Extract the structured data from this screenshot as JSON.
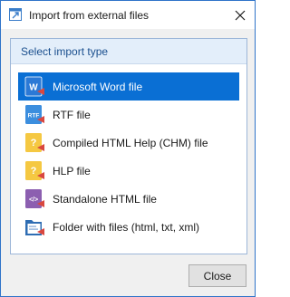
{
  "window": {
    "title": "Import from external files"
  },
  "group": {
    "title": "Select import type"
  },
  "items": [
    {
      "label": "Microsoft Word file",
      "icon": "word-doc-icon",
      "selected": true
    },
    {
      "label": "RTF file",
      "icon": "rtf-doc-icon",
      "selected": false
    },
    {
      "label": "Compiled HTML Help (CHM) file",
      "icon": "chm-help-icon",
      "selected": false
    },
    {
      "label": "HLP file",
      "icon": "hlp-help-icon",
      "selected": false
    },
    {
      "label": "Standalone HTML file",
      "icon": "html-code-icon",
      "selected": false
    },
    {
      "label": "Folder with files (html, txt, xml)",
      "icon": "folder-files-icon",
      "selected": false
    }
  ],
  "icon_texts": {
    "word": "W",
    "rtf": "RTF",
    "help": "?",
    "code": "</>"
  },
  "footer": {
    "close_label": "Close"
  },
  "colors": {
    "accent": "#0a6fd4",
    "frame": "#2f74c9",
    "header_bg": "#e3eefa",
    "header_text": "#1a4f8e"
  }
}
